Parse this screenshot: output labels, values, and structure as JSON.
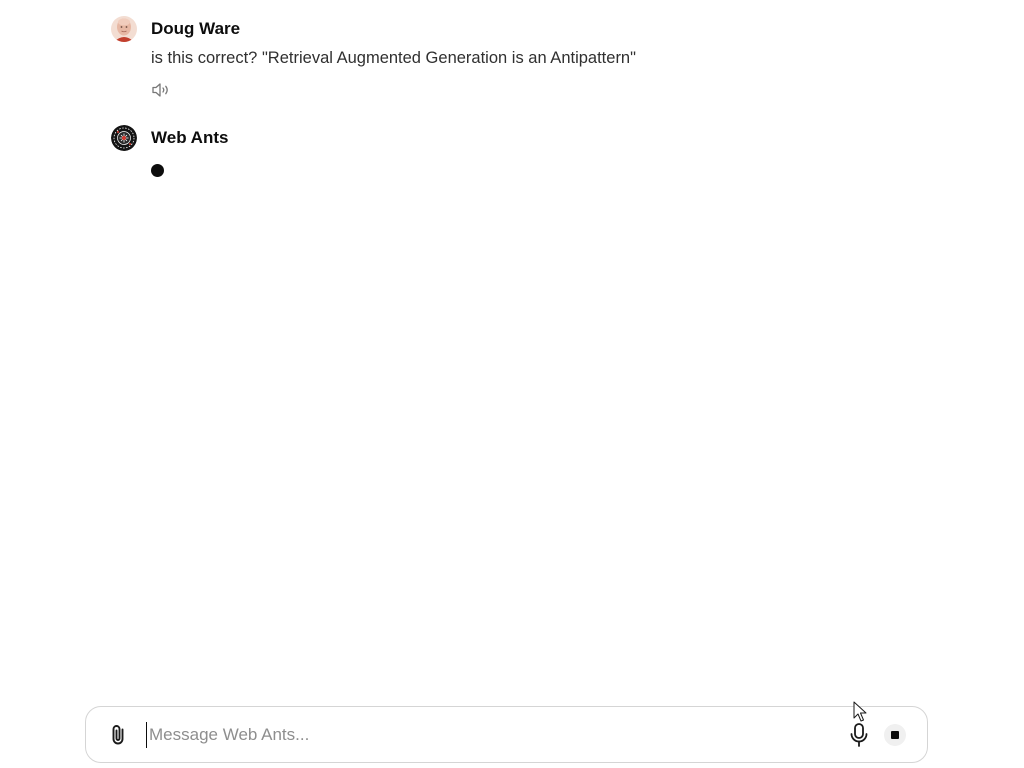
{
  "messages": [
    {
      "author": "Doug Ware",
      "text": "is this correct? \"Retrieval Augmented Generation is an Antipattern\"",
      "avatar_icon": "user-photo-avatar",
      "action_icon": "speaker-icon"
    },
    {
      "author": "Web Ants",
      "status": "typing",
      "avatar_icon": "web-ants-logo-avatar"
    }
  ],
  "composer": {
    "placeholder": "Message Web Ants...",
    "value": "",
    "attach_icon": "paperclip-icon",
    "mic_icon": "microphone-icon",
    "stop_icon": "stop-icon"
  },
  "colors": {
    "text_primary": "#0d0d0d",
    "text_body": "#303030",
    "placeholder": "#8e8e8e",
    "border": "#d5d5d5"
  }
}
